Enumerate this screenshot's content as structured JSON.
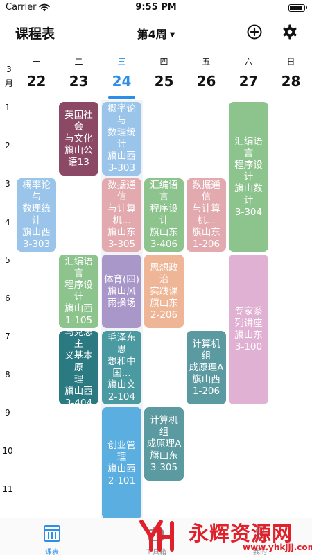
{
  "status_bar": {
    "carrier": "Carrier",
    "time": "9:55 PM",
    "battery_level": 0.95
  },
  "nav": {
    "title": "课程表",
    "week": "第4周"
  },
  "header": {
    "month": "3\n月",
    "days": [
      {
        "weekday": "一",
        "date": "22"
      },
      {
        "weekday": "二",
        "date": "23"
      },
      {
        "weekday": "三",
        "date": "24",
        "today": true
      },
      {
        "weekday": "四",
        "date": "25"
      },
      {
        "weekday": "五",
        "date": "26"
      },
      {
        "weekday": "六",
        "date": "27"
      },
      {
        "weekday": "日",
        "date": "28"
      }
    ]
  },
  "periods": [
    "1",
    "2",
    "3",
    "4",
    "5",
    "6",
    "7",
    "8",
    "9",
    "10",
    "11"
  ],
  "courses": [
    {
      "day": 2,
      "start": 1,
      "span": 2,
      "text": "英国社会\n与文化\n旗山公\n语13",
      "color": "#8c4965"
    },
    {
      "day": 3,
      "start": 1,
      "span": 2,
      "text": "概率论与\n数理统计\n旗山西\n3-303",
      "color": "#9ac4ea"
    },
    {
      "day": 6,
      "start": 1,
      "span": 4,
      "text": "汇编语言\n程序设计\n旗山数计\n3-304",
      "color": "#8dc48d"
    },
    {
      "day": 1,
      "start": 3,
      "span": 2,
      "text": "概率论与\n数理统计\n旗山西\n3-303",
      "color": "#9ac4ea"
    },
    {
      "day": 3,
      "start": 3,
      "span": 2,
      "text": "数据通信\n与计算\n机...\n旗山东\n3-305",
      "color": "#e2a9ae"
    },
    {
      "day": 4,
      "start": 3,
      "span": 2,
      "text": "汇编语言\n程序设计\n旗山东\n3-406",
      "color": "#8dc48d"
    },
    {
      "day": 5,
      "start": 3,
      "span": 2,
      "text": "数据通信\n与计算\n机...\n旗山东\n1-206",
      "color": "#e2a9ae"
    },
    {
      "day": 2,
      "start": 5,
      "span": 2,
      "text": "汇编语言\n程序设计\n旗山西\n1-105",
      "color": "#8dc48d"
    },
    {
      "day": 3,
      "start": 5,
      "span": 2,
      "text": "体育(四)\n旗山风\n雨操场",
      "color": "#a997c9"
    },
    {
      "day": 4,
      "start": 5,
      "span": 2,
      "text": "思想政治\n实践课\n旗山东\n2-206",
      "color": "#eeb697"
    },
    {
      "day": 6,
      "start": 5,
      "span": 4,
      "text": "专家系\n列讲座\n旗山东\n3-100",
      "color": "#e1b1d3"
    },
    {
      "day": 2,
      "start": 7,
      "span": 2,
      "text": "马克思主\n义基本原\n理\n旗山西\n3-404",
      "color": "#2b7a82"
    },
    {
      "day": 3,
      "start": 7,
      "span": 2,
      "text": "毛泽东思\n想和中\n国...\n旗山文\n2-104",
      "color": "#4b9aa2"
    },
    {
      "day": 5,
      "start": 7,
      "span": 2,
      "text": "计算机组\n成原理A\n旗山西\n1-206",
      "color": "#5b9aa0"
    },
    {
      "day": 3,
      "start": 9,
      "span": 3,
      "text": "创业管理\n旗山西\n2-101",
      "color": "#5aaee0"
    },
    {
      "day": 4,
      "start": 9,
      "span": 2,
      "text": "计算机组\n成原理A\n旗山东\n3-305",
      "color": "#5b9aa0"
    }
  ],
  "tabs": [
    {
      "label": "课表",
      "active": true
    },
    {
      "label": "工具箱"
    },
    {
      "label": "我的"
    }
  ],
  "watermark": {
    "text": "永辉资源网",
    "url": "www.yhkjjj.com"
  },
  "colors": {
    "accent": "#2d8ee8",
    "watermark": "#e0202a"
  }
}
